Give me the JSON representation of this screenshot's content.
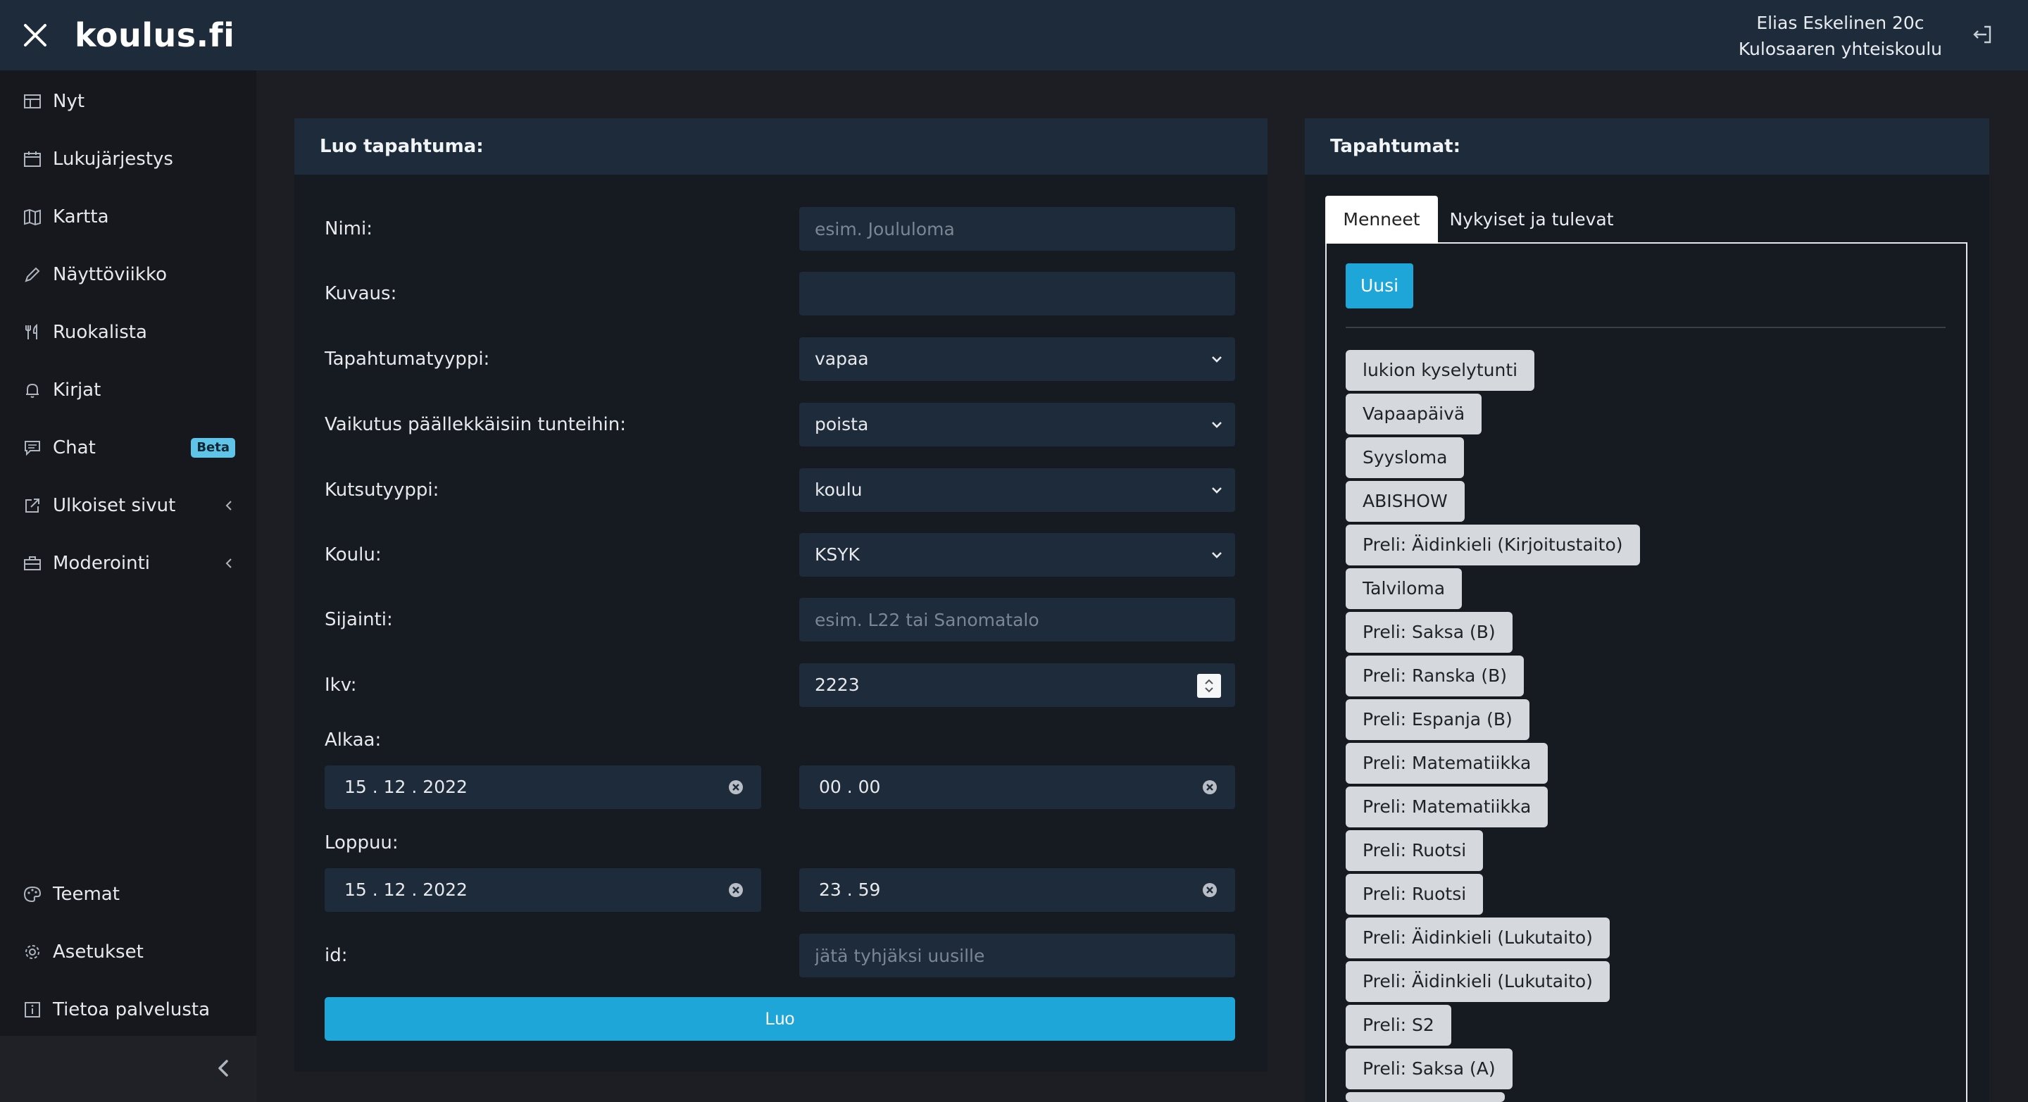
{
  "header": {
    "logo": "koulus.fi",
    "user_name": "Elias Eskelinen 20c",
    "school_name": "Kulosaaren yhteiskoulu"
  },
  "sidebar": {
    "items": [
      {
        "label": "Nyt",
        "icon": "table-icon"
      },
      {
        "label": "Lukujärjestys",
        "icon": "calendar-icon"
      },
      {
        "label": "Kartta",
        "icon": "map-icon"
      },
      {
        "label": "Näyttöviikko",
        "icon": "pencil-icon"
      },
      {
        "label": "Ruokalista",
        "icon": "fork-knife-icon"
      },
      {
        "label": "Kirjat",
        "icon": "bell-icon"
      },
      {
        "label": "Chat",
        "icon": "chat-icon",
        "badge": "Beta"
      },
      {
        "label": "Ulkoiset sivut",
        "icon": "external-link-icon"
      },
      {
        "label": "Moderointi",
        "icon": "toolbox-icon"
      }
    ],
    "bottom_items": [
      {
        "label": "Teemat",
        "icon": "palette-icon"
      },
      {
        "label": "Asetukset",
        "icon": "gear-icon"
      },
      {
        "label": "Tietoa palvelusta",
        "icon": "info-icon"
      }
    ]
  },
  "create_event": {
    "title": "Luo tapahtuma:",
    "name_label": "Nimi:",
    "name_placeholder": "esim. Joululoma",
    "description_label": "Kuvaus:",
    "event_type_label": "Tapahtumatyyppi:",
    "event_type_value": "vapaa",
    "overlap_label": "Vaikutus päällekkäisiin tunteihin:",
    "overlap_value": "poista",
    "invite_type_label": "Kutsutyyppi:",
    "invite_type_value": "koulu",
    "school_label": "Koulu:",
    "school_value": "KSYK",
    "location_label": "Sijainti:",
    "location_placeholder": "esim. L22 tai Sanomatalo",
    "ikv_label": "Ikv:",
    "ikv_value": "2223",
    "start_label": "Alkaa:",
    "start_date": "15 . 12 . 2022",
    "start_time": "00 . 00",
    "end_label": "Loppuu:",
    "end_date": "15 . 12 . 2022",
    "end_time": "23 . 59",
    "id_label": "id:",
    "id_placeholder": "jätä tyhjäksi uusille",
    "submit_label": "Luo"
  },
  "events": {
    "title": "Tapahtumat:",
    "tabs": [
      {
        "label": "Menneet",
        "active": true
      },
      {
        "label": "Nykyiset ja tulevat",
        "active": false
      }
    ],
    "new_button": "Uusi",
    "items": [
      "lukion kyselytunti",
      "Vapaapäivä",
      "Syysloma",
      "ABISHOW",
      "Preli: Äidinkieli (Kirjoitustaito)",
      "Talviloma",
      "Preli: Saksa (B)",
      "Preli: Ranska (B)",
      "Preli: Espanja (B)",
      "Preli: Matematiikka",
      "Preli: Matematiikka",
      "Preli: Ruotsi",
      "Preli: Ruotsi",
      "Preli: Äidinkieli (Lukutaito)",
      "Preli: Äidinkieli (Lukutaito)",
      "Preli: S2",
      "Preli: Saksa (A)"
    ]
  },
  "colors": {
    "accent": "#1fa6d8",
    "header_bg": "#1d2b3a",
    "sidebar_bg": "#17181d",
    "chip_bg": "#d5d8dc"
  }
}
